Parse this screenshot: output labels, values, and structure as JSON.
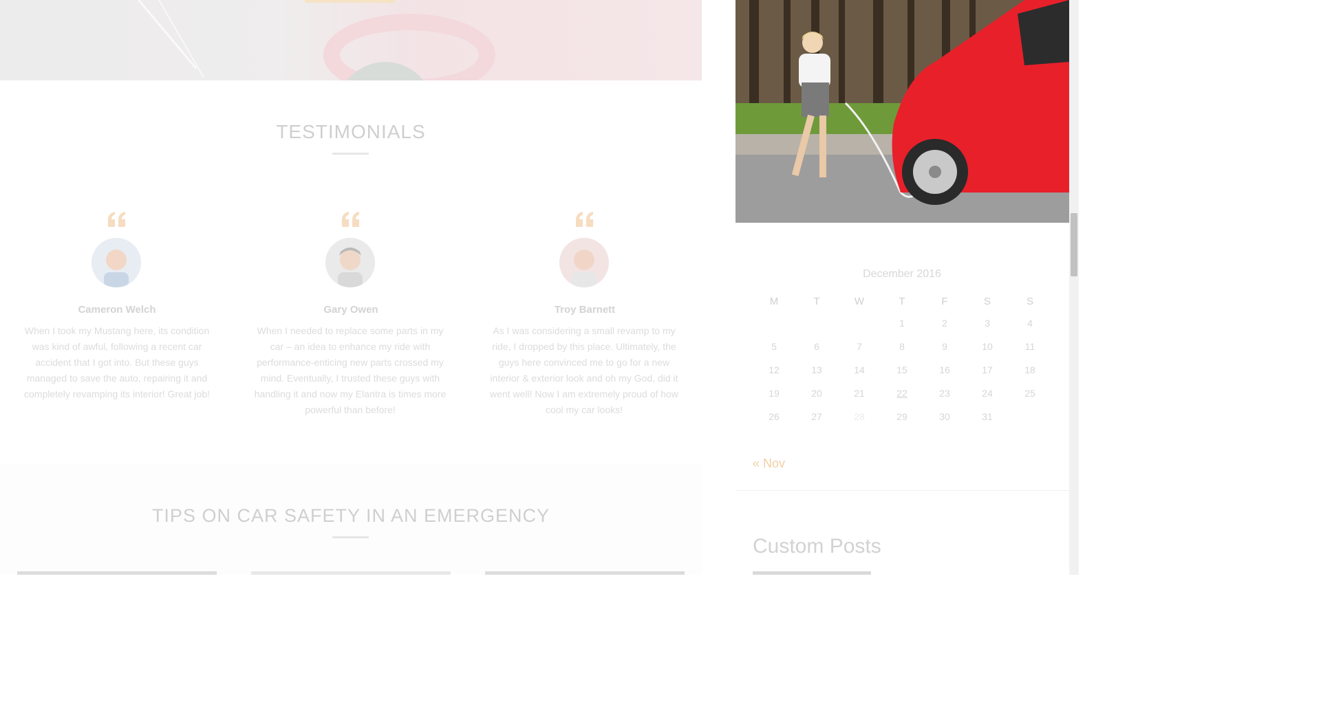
{
  "testimonials": {
    "title": "TESTIMONIALS",
    "items": [
      {
        "name": "Cameron Welch",
        "text": "When I took my Mustang here, its condition was kind of awful, following a recent car accident that I got into. But these guys managed to save the auto, repairing it and completely revamping its interior! Great job!"
      },
      {
        "name": "Gary Owen",
        "text": "When I needed to replace some parts in my car – an idea to enhance my ride with performance-enticing new parts crossed my mind. Eventually, I trusted these guys with handling it and now my Elantra is times more powerful than before!"
      },
      {
        "name": "Troy Barnett",
        "text": "As I was considering a small revamp to my ride, I dropped by this place. Ultimately, the guys here convinced me to go for a new interior & exterior look and oh my God, did it went well! Now I am extremely proud of how cool my car looks!"
      }
    ]
  },
  "tips": {
    "title": "TIPS ON CAR SAFETY IN AN EMERGENCY"
  },
  "calendar": {
    "caption": "December 2016",
    "weekdays": [
      "M",
      "T",
      "W",
      "T",
      "F",
      "S",
      "S"
    ],
    "rows": [
      [
        "",
        "",
        "",
        "1",
        "2",
        "3",
        "4"
      ],
      [
        "5",
        "6",
        "7",
        "8",
        "9",
        "10",
        "11"
      ],
      [
        "12",
        "13",
        "14",
        "15",
        "16",
        "17",
        "18"
      ],
      [
        "19",
        "20",
        "21",
        "22",
        "23",
        "24",
        "25"
      ],
      [
        "26",
        "27",
        "28",
        "29",
        "30",
        "31",
        ""
      ]
    ],
    "linked_day": "22",
    "prev_link": "« Nov"
  },
  "sidebar": {
    "custom_posts_title": "Custom Posts"
  },
  "colors": {
    "accent": "#f2cfa3",
    "muted_text": "#d6d6d6"
  }
}
